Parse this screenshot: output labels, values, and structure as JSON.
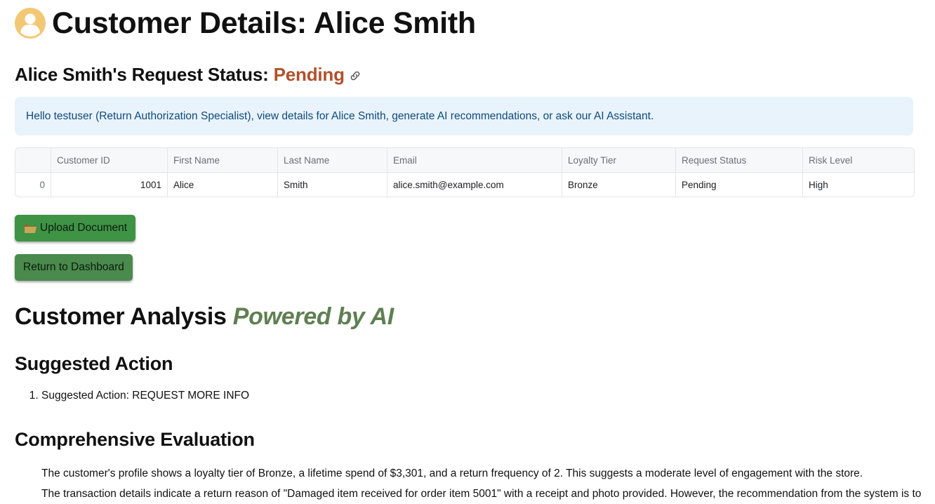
{
  "header": {
    "title": "Customer Details: Alice Smith",
    "avatar_icon": "user-avatar-icon"
  },
  "status": {
    "prefix": "Alice Smith's Request Status: ",
    "value": "Pending",
    "value_color": "#b0512b",
    "link_icon": "link-icon"
  },
  "info": {
    "message": "Hello testuser (Return Authorization Specialist), view details for Alice Smith, generate AI recommendations, or ask our AI Assistant."
  },
  "table": {
    "columns": [
      "",
      "Customer ID",
      "First Name",
      "Last Name",
      "Email",
      "Loyalty Tier",
      "Request Status",
      "Risk Level"
    ],
    "rows": [
      [
        "0",
        "1001",
        "Alice",
        "Smith",
        "alice.smith@example.com",
        "Bronze",
        "Pending",
        "High"
      ]
    ]
  },
  "buttons": {
    "upload_label": "Upload Document",
    "upload_icon": "folder-icon",
    "return_label": "Return to Dashboard",
    "accent_color": "#3e9345"
  },
  "analysis": {
    "heading_plain": "Customer Analysis ",
    "heading_accent": "Powered by AI",
    "accent_color": "#5f7f52"
  },
  "suggested": {
    "heading": "Suggested Action",
    "items": [
      "Suggested Action: REQUEST MORE INFO"
    ]
  },
  "evaluation": {
    "heading": "Comprehensive Evaluation",
    "items": [
      "The customer's profile shows a loyalty tier of Bronze, a lifetime spend of $3,301, and a return frequency of 2. This suggests a moderate level of engagement with the store.",
      "The transaction details indicate a return reason of \"Damaged item received for order item 5001\" with a receipt and photo provided. However, the recommendation from the system is to"
    ]
  }
}
